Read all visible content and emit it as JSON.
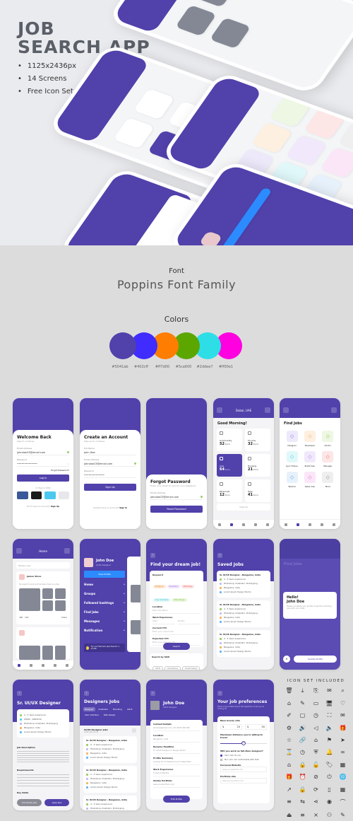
{
  "hero": {
    "title_line1": "JOB",
    "title_line2": "SEARCH APP",
    "bullets": [
      "1125x2436px",
      "14 Screens",
      "Free Icon Set"
    ]
  },
  "font_section": {
    "label": "Font",
    "name": "Poppins Font Family"
  },
  "colors_section": {
    "label": "Colors",
    "swatches": [
      {
        "hex": "#5041ab",
        "label": "#5041ab"
      },
      {
        "hex": "#402cff",
        "label": "#402cff"
      },
      {
        "hex": "#ff7d00",
        "label": "#ff7d00"
      },
      {
        "hex": "#5ca600",
        "label": "#5ca600"
      },
      {
        "hex": "#2ddee7",
        "label": "#2ddee7"
      },
      {
        "hex": "#ff00e1",
        "label": "#ff00e1"
      }
    ]
  },
  "screens": {
    "login": {
      "title": "Welcome Back",
      "subtitle": "Sign to continue",
      "email_label": "Email Address",
      "email_value": "johndoe23@email.com",
      "password_label": "Password",
      "password_value": "••••••••••••••",
      "forgot": "Forgot Password?",
      "button": "Log In",
      "or_text": "Or Sign In With",
      "footer": "Don't have an account?",
      "footer_link": "Sign Up"
    },
    "signup": {
      "title": "Create an Account",
      "subtitle": "Sign up to continue",
      "name_label": "Full Name",
      "name_value": "John Doe",
      "email_label": "Email Address",
      "email_value": "johndoe23@email.com",
      "password_label": "Password",
      "password_value": "••••••••••••••",
      "button": "Sign Up",
      "footer": "Already have an account?",
      "footer_link": "Sign In"
    },
    "forgot": {
      "title": "Forgot Password",
      "subtitle": "Enter your email to recover your password",
      "email_label": "Email Address",
      "email_value": "johndoe23@email.com",
      "button": "Reset Password"
    },
    "dashboard": {
      "location": "Dubai, UAE",
      "greeting": "Good Morning!",
      "tiles": [
        {
          "name": "Community",
          "count": "52",
          "unit": "Items"
        },
        {
          "name": "Forums",
          "count": "32",
          "unit": "Items"
        },
        {
          "name": "Jobs",
          "count": "64",
          "unit": "Items"
        },
        {
          "name": "Housing",
          "count": "21",
          "unit": "Items"
        },
        {
          "name": "Personals",
          "count": "12",
          "unit": "Items"
        },
        {
          "name": "Gigs",
          "count": "41",
          "unit": "Items"
        }
      ],
      "view_all": "View All"
    },
    "find_jobs": {
      "title": "Find Jobs",
      "categories": [
        {
          "label": "Designer",
          "bg": "#ede9fb",
          "fg": "#7b6ee0"
        },
        {
          "label": "Developer",
          "bg": "#fdf0e0",
          "fg": "#f2a74a"
        },
        {
          "label": "Doctor",
          "bg": "#eef7e3",
          "fg": "#86c34a"
        },
        {
          "label": "Gym Trainer",
          "bg": "#e0f8fa",
          "fg": "#3fc7d1"
        },
        {
          "label": "Electrician",
          "bg": "#f1e9fb",
          "fg": "#a67ee0"
        },
        {
          "label": "Manager",
          "bg": "#fde6e6",
          "fg": "#e26d6d"
        },
        {
          "label": "Teacher",
          "bg": "#e6f1fb",
          "fg": "#5b9ee0"
        },
        {
          "label": "Sales man",
          "bg": "#fbe6f8",
          "fg": "#d86ad0"
        },
        {
          "label": "More",
          "bg": "#efefef",
          "fg": "#888"
        }
      ]
    },
    "home_feed": {
      "title": "Home",
      "search_placeholder": "What's new",
      "post_author": "James Vince",
      "post_sub": "Message",
      "post_text": "No report to quit and be take, fresh you like",
      "likes": "490",
      "comments": "190",
      "share": "Share"
    },
    "menu": {
      "name": "John Doe",
      "role": "UI/UX Designer",
      "view_profile": "View Profile",
      "items": [
        "Home",
        "Groups",
        "Followed hashtags",
        "Find Jobs",
        "Messages",
        "Notification"
      ],
      "promo": "Try our Premium plan free for 1 month"
    },
    "dream_job": {
      "title": "Find your dream job!",
      "keyword_label": "Keyword",
      "chips": [
        {
          "label": "Designer",
          "bg": "#fde8d4",
          "fg": "#e5893a"
        },
        {
          "label": "Illustrator",
          "bg": "#f1e6fb",
          "fg": "#a17ad8"
        },
        {
          "label": "Branding",
          "bg": "#fde2e2",
          "fg": "#e26363"
        },
        {
          "label": "User Interface",
          "bg": "#ddf6f8",
          "fg": "#39c0ca"
        },
        {
          "label": "Web Design",
          "bg": "#e9f6dc",
          "fg": "#7fbf45"
        }
      ],
      "location_label": "Location",
      "location_placeholder": "Enter City Name",
      "experience_label": "Work Experience",
      "exp_years": "Years",
      "exp_months": "Months",
      "current_ctc_label": "Current CTC",
      "current_ctc_placeholder": "Enter your current CTC",
      "expected_ctc_label": "Expected CTC",
      "expected_ctc_placeholder": "Enter your expected CTC",
      "search_button": "Search",
      "skill_label": "Search by Skill",
      "skills": [
        "UI/UX",
        "Developing",
        "Visual Design",
        "Experience Design",
        "User Interface"
      ]
    },
    "saved_jobs": {
      "title": "Saved Jobs",
      "jobs": [
        {
          "title": "Sr. UI/UX Designer - Bangalore, India",
          "rows": [
            "4 - 5 Years experience",
            "Photoshop, Illustrator, Prototyping",
            "Bangalore, India",
            "Lorem Ipsum Design Studio"
          ]
        },
        {
          "title": "Sr. UI/UX Designer - Bangalore, India",
          "rows": [
            "4 - 5 Years experience",
            "Photoshop, Illustrator, Prototyping",
            "Bangalore, India",
            "Lorem Ipsum Design Studio"
          ]
        },
        {
          "title": "Sr. UI/UX Designer - Bangalore, India",
          "rows": [
            "4 - 5 Years experience",
            "Photoshop, Illustrator, Prototyping",
            "Bangalore, India",
            "Lorem Ipsum Design Studio"
          ]
        }
      ]
    },
    "hello_modal": {
      "bg_title": "Find Jobs",
      "greeting": "Hello!",
      "name": "John Doe",
      "message": "Please complete your profile to get the matching jobs with your skills",
      "button": "Update Profile"
    },
    "job_detail": {
      "title": "Sr. UI/UX Designer",
      "rows": [
        "4 - 5 Years experience",
        "$5000 - $8000 PA",
        "Photoshop, Illustrator, Prototyping",
        "Bangalore, India",
        "Lorem Ipsum Design Studio"
      ],
      "desc_label": "Job Description",
      "req_label": "Requirements",
      "skills_label": "Key Skills",
      "btn_secondary": "Find Similar Jobs",
      "btn_primary": "Apply Now"
    },
    "designer_jobs": {
      "title": "Designers Jobs",
      "tabs": [
        "Designer",
        "Illustrator",
        "Branding",
        "UI/UX",
        "User Interface",
        "Web Design"
      ],
      "list_title": "UI/UX Designer Jobs",
      "list_sub": "1045 jobs found",
      "job_title": "Sr. UI/UX Designer - Bangalore, India",
      "rows": [
        "4 - 5 Years experience",
        "Photoshop, Illustrator, Prototyping",
        "Bangalore, India",
        "Lorem Ipsum Design Studio"
      ]
    },
    "profile": {
      "name": "John Doe",
      "role": "UI/UX Designer",
      "fields": [
        {
          "label": "Contact Details",
          "value": "johndoe@email.com +91 9000 000 000"
        },
        {
          "label": "Location",
          "value": "Bangalore, India"
        },
        {
          "label": "Resume Headline",
          "value": "Sr. UI/UX Designer in Design Studio"
        },
        {
          "label": "Profile Summary",
          "value": "Looking for UX Research job in New Delhi"
        },
        {
          "label": "Work Experience",
          "value": "5 Years   6 Months"
        },
        {
          "label": "Online Portfolio",
          "value": "www.yourportfolio.com"
        }
      ],
      "button": "Edit Profile"
    },
    "preferences": {
      "title": "Your job preferences",
      "subtitle": "Share some details about the type/time of job you're looking for",
      "rate_label": "Base hourly rate",
      "rate_min": "20",
      "rate_max": "50",
      "distance_label": "Maximum distance you're willing to travel",
      "distance_value": "500",
      "fulltime_label": "Will you work as full-time designer?",
      "option1": "Yes! I will do you",
      "option2": "No! I am not comfortable with that",
      "website_label": "Personal Website",
      "website_placeholder": "www.yourwebsite.com",
      "portfolio_label": "Portfolio site",
      "portfolio_placeholder": "www.yourportfolio.com"
    }
  },
  "icon_set": {
    "title": "ICON SET INCLUDED",
    "icons": [
      "🗑",
      "⤓",
      "⎘",
      "✉",
      "⌕",
      "⌂",
      "✎",
      "▭",
      "🖥",
      "♡",
      "✐",
      "▢",
      "◷",
      "⛶",
      "✉",
      "⚙",
      "🔊",
      "◁",
      "🔈",
      "🎁",
      "☆",
      "🔗",
      "⌂",
      "⚑",
      "➤",
      "⌛",
      "◷",
      "⛨",
      "🔔",
      "∞",
      "⌂",
      "🔒",
      "🔓",
      "🏷",
      "▦",
      "🎁",
      "⏰",
      "⊘",
      "⏻",
      "🌐",
      "↗",
      "🔒",
      "⟳",
      "▯",
      "▦",
      "≡",
      "⇆",
      "⋖",
      "◉",
      "⌒",
      "⏏",
      "≡",
      "×",
      "⚇",
      "✎"
    ]
  }
}
